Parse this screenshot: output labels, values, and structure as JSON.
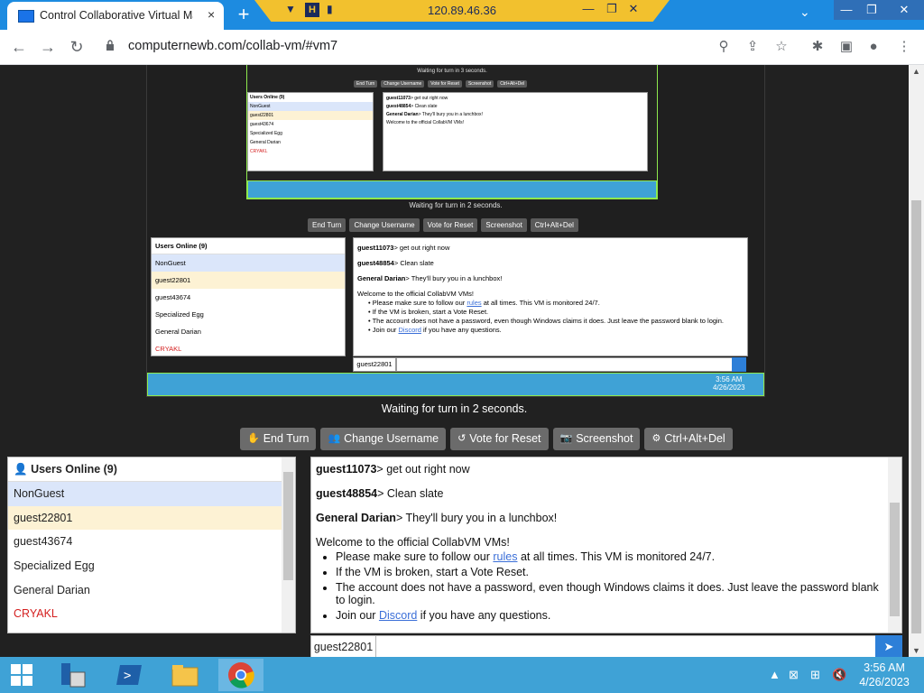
{
  "browser": {
    "tab_title": "Control Collaborative Virtual Mac",
    "tab_close": "×",
    "new_tab": "+",
    "url": "computernewb.com/collab-vm/#vm7"
  },
  "rdp": {
    "ip": "120.89.46.36"
  },
  "nested_vm": {
    "tiny_wait": "Waiting for turn in 3 seconds.",
    "mid_wait": "Waiting for turn in 2 seconds.",
    "mid_time": "3:56 AM",
    "mid_date": "4/26/2023"
  },
  "turn_status": "Waiting for turn in 2 seconds.",
  "controls": {
    "end_turn": "End Turn",
    "change_username": "Change Username",
    "vote_reset": "Vote for Reset",
    "screenshot": "Screenshot",
    "cad": "Ctrl+Alt+Del"
  },
  "users": {
    "header": "Users Online (9)",
    "items": [
      {
        "name": "NonGuest",
        "bg": "#dbe6fa",
        "color": "#222222"
      },
      {
        "name": "guest22801",
        "bg": "#fdf2d4",
        "color": "#222222"
      },
      {
        "name": "guest43674",
        "bg": "#ffffff",
        "color": "#222222"
      },
      {
        "name": "Specialized Egg",
        "bg": "#ffffff",
        "color": "#222222"
      },
      {
        "name": "General Darian",
        "bg": "#ffffff",
        "color": "#222222"
      },
      {
        "name": "CRYAKL",
        "bg": "#ffffff",
        "color": "#d41f1f"
      }
    ]
  },
  "chat": {
    "messages": [
      {
        "user": "guest11073",
        "text": "get out right now"
      },
      {
        "user": "guest48854",
        "text": "Clean slate"
      },
      {
        "user": "General Darian",
        "text": "They'll bury you in a lunchbox!"
      }
    ],
    "welcome": "Welcome to the official CollabVM VMs!",
    "rules": {
      "pre": "Please make sure to follow our ",
      "link": "rules",
      "post": " at all times. This VM is monitored 24/7."
    },
    "broken": "If the VM is broken, start a Vote Reset.",
    "password": "The account does not have a password, even though Windows claims it does. Just leave the password blank to login.",
    "discord": {
      "pre": "Join our ",
      "link": "Discord",
      "post": " if you have any questions."
    }
  },
  "chat_username": "guest22801",
  "taskbar": {
    "time": "3:56 AM",
    "date": "4/26/2023"
  },
  "colors": {
    "accent": "#1d8be0",
    "taskbar": "#3fa2d6",
    "button": "#6b6b6b",
    "send": "#2d7fd8"
  }
}
